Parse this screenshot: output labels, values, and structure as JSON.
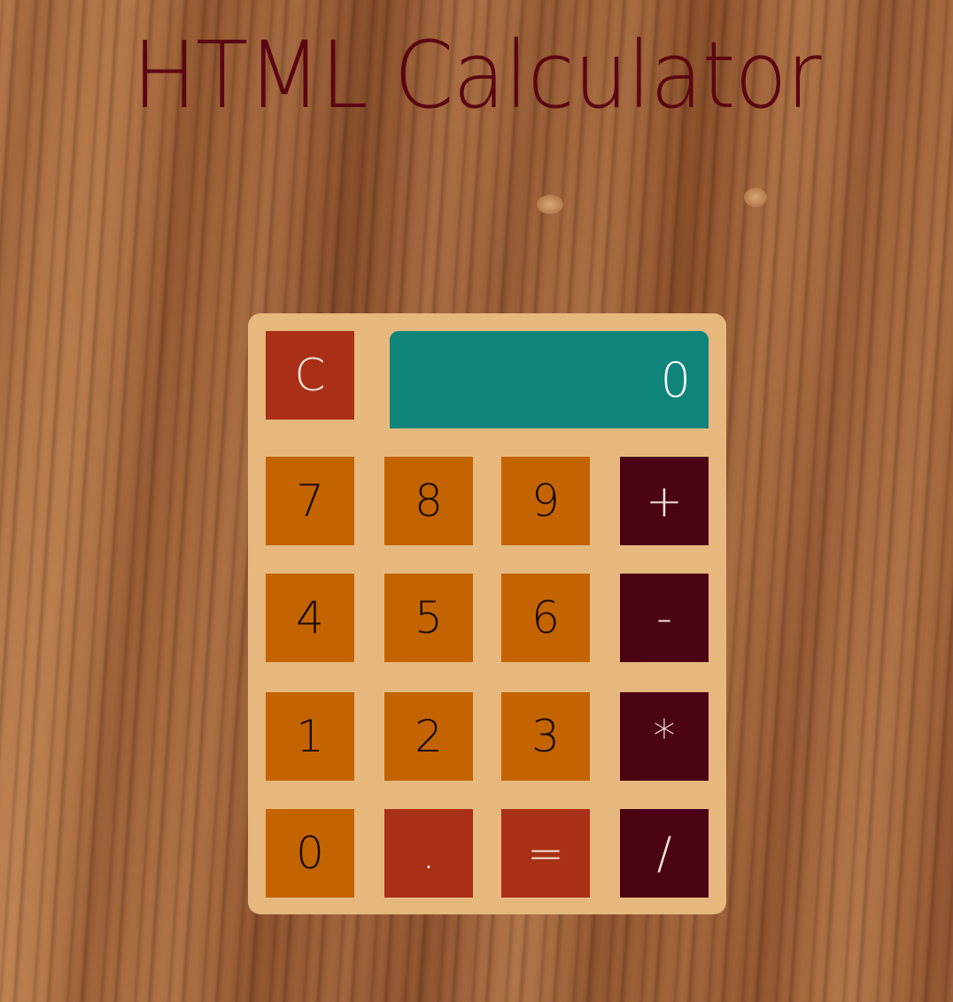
{
  "title": "HTML Calculator",
  "display": {
    "value": "0"
  },
  "keys": {
    "clear": "C",
    "seven": "7",
    "eight": "8",
    "nine": "9",
    "plus": "+",
    "four": "4",
    "five": "5",
    "six": "6",
    "minus": "-",
    "one": "1",
    "two": "2",
    "three": "3",
    "multiply": "*",
    "zero": "0",
    "decimal": ".",
    "equals": "=",
    "divide": "/"
  },
  "colors": {
    "title": "#5b0713",
    "panel": "#e6b87e",
    "digit_key": "#c36400",
    "clear_key": "#a92f16",
    "operator_key": "#4b0213",
    "display": "#0e847a"
  }
}
